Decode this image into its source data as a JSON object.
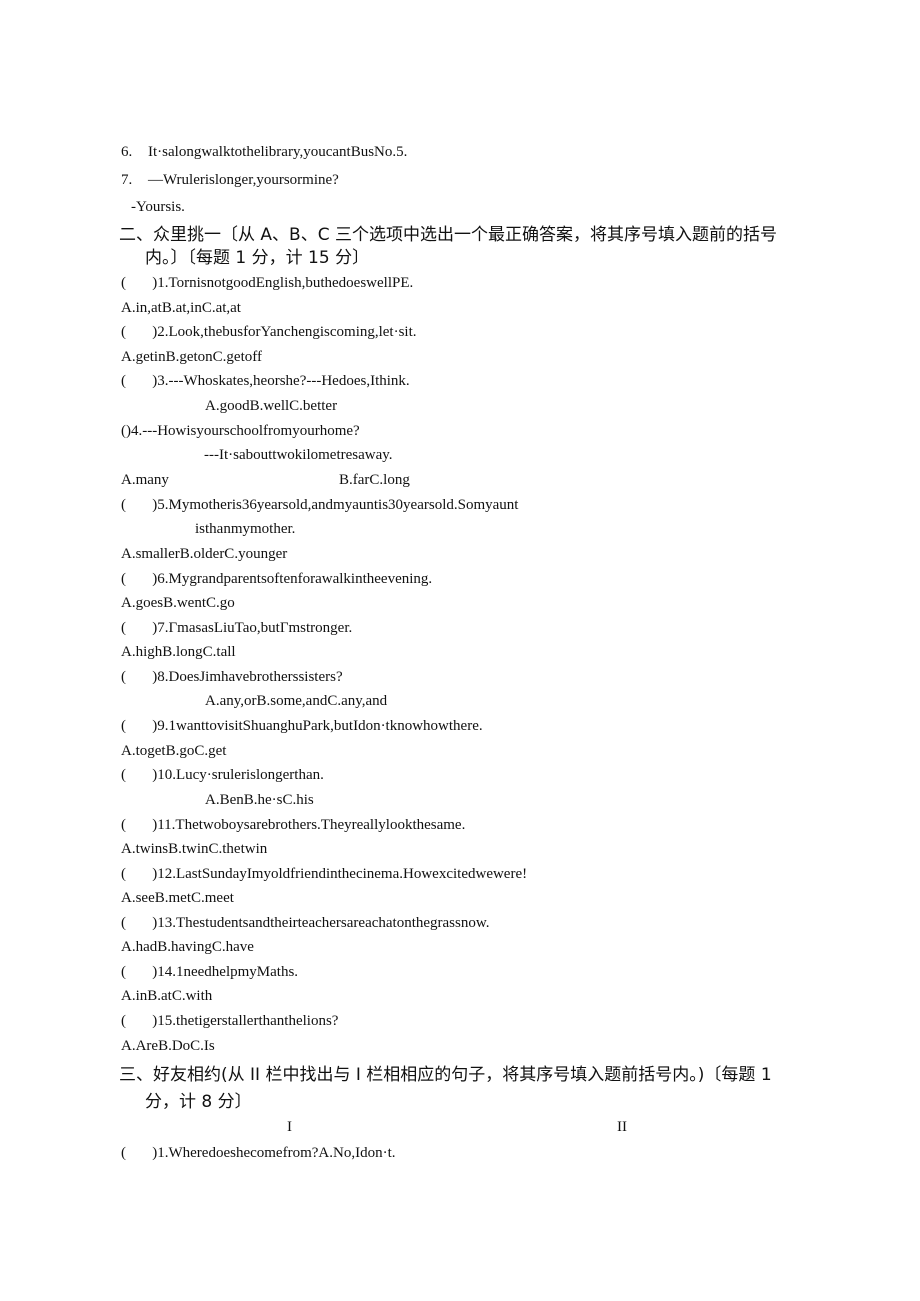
{
  "section1_tail": {
    "q6": {
      "num": "6.",
      "text": "It·salongwalktothelibrary,youcantBusNo.5."
    },
    "q7": {
      "num": "7.",
      "text": "—Wrulerislonger,yoursormine?"
    },
    "q7_answer": "-Yoursis."
  },
  "section2": {
    "heading_line1": "二、众里挑一〔从 A、B、C 三个选项中选出一个最正确答案，将其序号填入题前的括号",
    "heading_line2": "内。〕〔每题 1 分，计 15 分〕",
    "questions": [
      {
        "stem": "(       )1.TornisnotgoodEnglish,buthedoeswellPE.",
        "options": "A.in,atB.at,inC.at,at"
      },
      {
        "stem": "(       )2.Look,thebusforYanchengiscoming,let·sit.",
        "options": "A.getinB.getonC.getoff"
      },
      {
        "stem": "(       )3.---Whoskates,heorshe?---Hedoes,Ithink.",
        "options": "A.goodB.wellC.better"
      },
      {
        "stem": "()4.---Howisyourschoolfromyourhome?",
        "stem2": "---It·sabouttwokilometresaway.",
        "options_a": "A.many",
        "options_bc": "B.farC.long"
      },
      {
        "stem": "(       )5.Mymotheris36yearsold,andmyauntis30yearsold.Somyaunt",
        "stem2": "isthanmymother.",
        "options": "A.smallerB.olderC.younger"
      },
      {
        "stem": "(       )6.Mygrandparentsoftenforawalkintheevening.",
        "options": "A.goesB.wentC.go"
      },
      {
        "stem": "(       )7.ΓmasasLiuTao,butΓmstronger.",
        "options": "A.highB.longC.tall"
      },
      {
        "stem": "(       )8.DoesJimhavebrotherssisters?",
        "options": "A.any,orB.some,andC.any,and"
      },
      {
        "stem": "(       )9.1wanttovisitShuanghuPark,butIdon·tknowhowthere.",
        "options": "A.togetB.goC.get"
      },
      {
        "stem": "(       )10.Lucy·srulerislongerthan.",
        "options": "A.BenB.he·sC.his"
      },
      {
        "stem": "(       )11.Thetwoboysarebrothers.Theyreallylookthesame.",
        "options": "A.twinsB.twinC.thetwin"
      },
      {
        "stem": "(       )12.LastSundayImyoldfriendinthecinema.Howexcitedwewere!",
        "options": "A.seeB.metC.meet"
      },
      {
        "stem": "(       )13.Thestudentsandtheirteachersareachatonthegrassnow.",
        "options": "A.hadB.havingC.have"
      },
      {
        "stem": "(       )14.1needhelpmyMaths.",
        "options": "A.inB.atC.with"
      },
      {
        "stem": "(       )15.thetigerstallerthanthelions?",
        "options": "A.AreB.DoC.Is"
      }
    ]
  },
  "section3": {
    "heading_line1": "三、好友相约(从 II 栏中找出与 I 栏相相应的句子，将其序号填入题前括号内。)〔每题 1",
    "heading_line2": "分，计 8 分〕",
    "col1_label": "I",
    "col2_label": "II",
    "row1": "(       )1.Wheredoeshecomefrom?A.No,Idon·t."
  }
}
